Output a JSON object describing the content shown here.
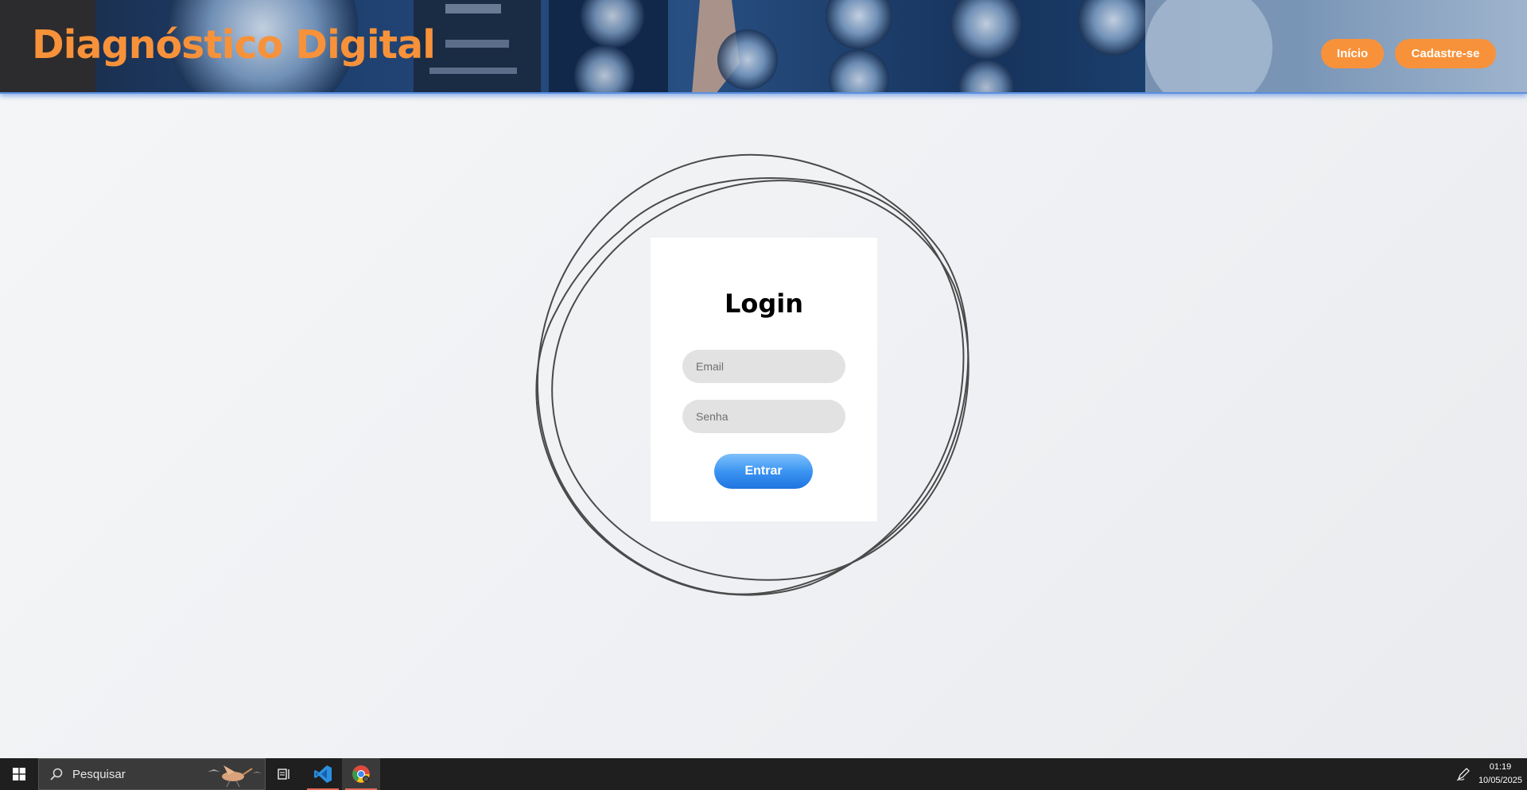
{
  "header": {
    "brand": "Diagnóstico Digital",
    "nav": [
      {
        "label": "Início"
      },
      {
        "label": "Cadastre-se"
      }
    ],
    "accent_color": "#f7923a"
  },
  "login": {
    "title": "Login",
    "email_placeholder": "Email",
    "password_placeholder": "Senha",
    "submit_label": "Entrar",
    "button_color": "#3c95f2"
  },
  "taskbar": {
    "search_placeholder": "Pesquisar",
    "time": "01:19",
    "date": "10/05/2025",
    "icons": [
      "windows-start-icon",
      "search-icon",
      "task-view-icon",
      "vscode-icon",
      "chrome-icon",
      "pen-icon"
    ]
  }
}
